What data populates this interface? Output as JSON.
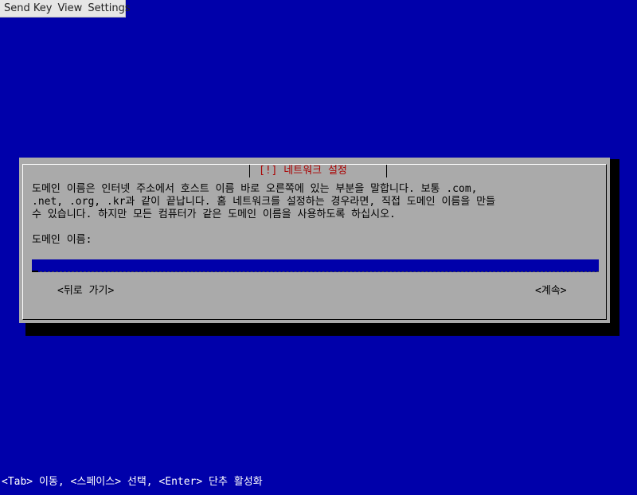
{
  "menubar": {
    "send_key": "Send Key",
    "view": "View",
    "settings": "Settings"
  },
  "dialog": {
    "title": "[!] 네트워크 설정",
    "text": "도메인 이름은 인터넷 주소에서 호스트 이름 바로 오른쪽에 있는 부분을 말합니다. 보통 .com,\n.net, .org, .kr과 같이 끝납니다. 홈 네트워크를 설정하는 경우라면, 직접 도메인 이름을 만들\n수 있습니다. 하지만 모든 컴퓨터가 같은 도메인 이름을 사용하도록 하십시오.",
    "field_label": "도메인 이름:",
    "field_value": "",
    "back_button": "<뒤로 가기>",
    "continue_button": "<계속>"
  },
  "statusbar": "<Tab> 이동, <스페이스> 선택, <Enter> 단추 활성화",
  "colors": {
    "background": "#0000aa",
    "dialog": "#aaaaaa",
    "title": "#aa0000",
    "field": "#0000aa"
  }
}
